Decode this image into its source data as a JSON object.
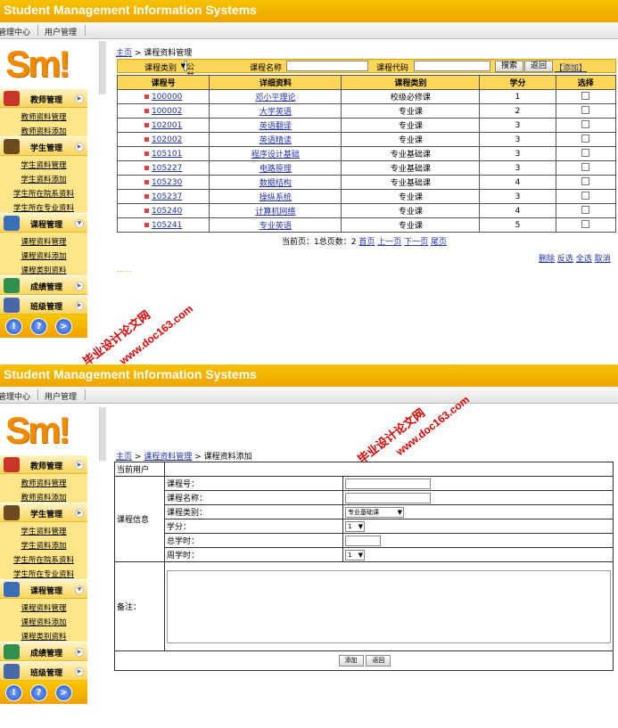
{
  "app_title": "Student Management Information Systems",
  "nav": {
    "tab1": "管理中心",
    "tab2": "用户管理"
  },
  "logo": "Sm!",
  "sidebar": {
    "teacher": {
      "title": "教师管理",
      "items": [
        "教师资料管理",
        "教师资料添加"
      ]
    },
    "student": {
      "title": "学生管理",
      "items": [
        "学生资料管理",
        "学生资料添加",
        "学生所在院系资料",
        "学生所在专业资料"
      ]
    },
    "course": {
      "title": "课程管理",
      "items": [
        "课程资料管理",
        "课程资料添加",
        "课程类别资料"
      ]
    },
    "grade": {
      "title": "成绩管理"
    },
    "class": {
      "title": "班级管理"
    },
    "bottom_icons": [
      "!",
      "?",
      ">"
    ]
  },
  "shot1": {
    "crumb_home": "主页",
    "crumb_sep": " > ",
    "crumb_current": "课程资料管理",
    "filter": {
      "type_label": "课程类别",
      "type_value": "公共课",
      "name_label": "课程名称",
      "code_label": "课程代码",
      "search_btn": "搜索",
      "reset_btn": "返回",
      "add_link": "【添加】"
    },
    "columns": [
      "课程号",
      "详细资料",
      "课程类别",
      "学分",
      "选择"
    ],
    "rows": [
      {
        "code": "100000",
        "name": "邓小平理论",
        "type": "校级必修课",
        "credit": "1"
      },
      {
        "code": "100002",
        "name": "大学英语",
        "type": "专业课",
        "credit": "2"
      },
      {
        "code": "102001",
        "name": "英语翻译",
        "type": "专业课",
        "credit": "3"
      },
      {
        "code": "102002",
        "name": "英语精读",
        "type": "专业课",
        "credit": "3"
      },
      {
        "code": "105101",
        "name": "程序设计基础",
        "type": "专业基础课",
        "credit": "3"
      },
      {
        "code": "105227",
        "name": "电路原理",
        "type": "专业基础课",
        "credit": "3"
      },
      {
        "code": "105230",
        "name": "数据结构",
        "type": "专业基础课",
        "credit": "4"
      },
      {
        "code": "105237",
        "name": "操纵系统",
        "type": "专业课",
        "credit": "3"
      },
      {
        "code": "105240",
        "name": "计算机网络",
        "type": "专业课",
        "credit": "4"
      },
      {
        "code": "105241",
        "name": "专业英语",
        "type": "专业课",
        "credit": "5"
      }
    ],
    "pager": {
      "text": "当前页：1总页数：2",
      "first": "首页",
      "prev": "上一页",
      "next": "下一页",
      "last": "尾页"
    },
    "actions": {
      "delete": "删除",
      "invert": "反选",
      "all": "全选",
      "cancel": "取消"
    },
    "dots": "......"
  },
  "shot2": {
    "crumb_home": "主页",
    "crumb_mid": "课程资料管理",
    "crumb_current": "课程资料添加",
    "current_user": "当前用户",
    "course_info": "课程信息",
    "fields": {
      "code": "课程号：",
      "name": "课程名称：",
      "type": "课程类别：",
      "credit": "学分：",
      "total_hours": "总学时：",
      "week_hours": "周学时："
    },
    "type_value": "专业基础课",
    "credit_value": "1",
    "week_value": "1",
    "remark": "备注：",
    "add_btn": "添加",
    "back_btn": "返回"
  },
  "watermark": {
    "cn": "毕业设计论文网",
    "url": "www.doc163.com"
  }
}
